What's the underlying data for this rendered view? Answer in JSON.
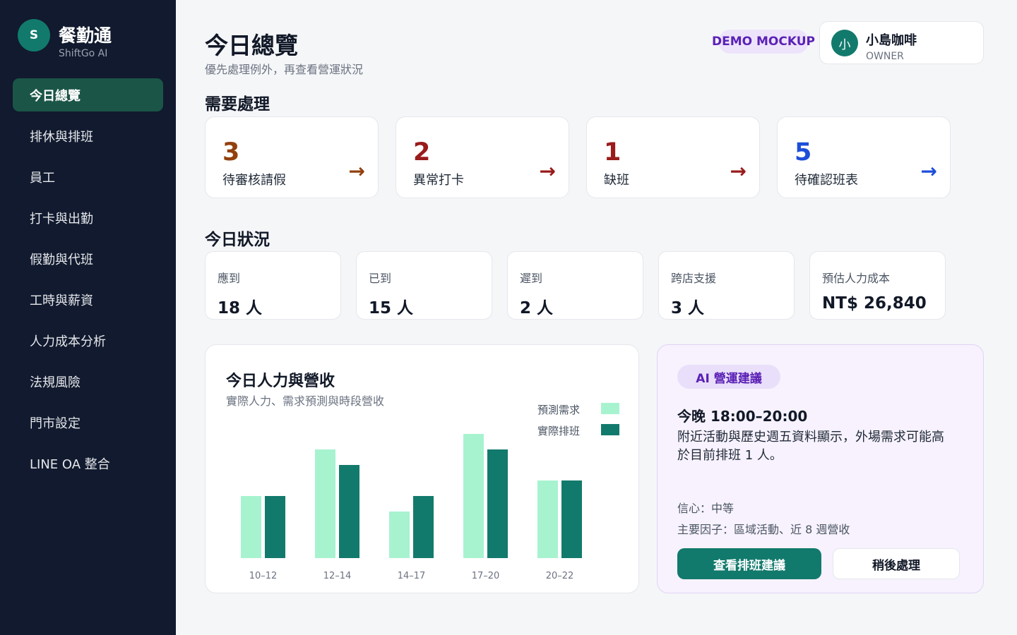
{
  "brand": {
    "logo_letter": "S",
    "name": "餐勤通",
    "subtitle": "ShiftGo AI"
  },
  "sidebar": {
    "items": [
      {
        "label": "今日總覽",
        "active": true
      },
      {
        "label": "排休與排班"
      },
      {
        "label": "員工"
      },
      {
        "label": "打卡與出勤"
      },
      {
        "label": "假勤與代班"
      },
      {
        "label": "工時與薪資"
      },
      {
        "label": "人力成本分析"
      },
      {
        "label": "法規風險"
      },
      {
        "label": "門市設定"
      },
      {
        "label": "LINE OA 整合"
      }
    ]
  },
  "header": {
    "title": "今日總覽",
    "subtitle": "優先處理例外，再查看營運狀況",
    "demo_badge": "DEMO MOCKUP",
    "user": {
      "avatar_letter": "小",
      "name": "小島咖啡",
      "role": "OWNER"
    }
  },
  "needs_attention": {
    "title": "需要處理",
    "cards": [
      {
        "count": "3",
        "label": "待審核請假",
        "color": "#92400e",
        "arrow": "→"
      },
      {
        "count": "2",
        "label": "異常打卡",
        "color": "#991b1b",
        "arrow": "→"
      },
      {
        "count": "1",
        "label": "缺班",
        "color": "#991b1b",
        "arrow": "→"
      },
      {
        "count": "5",
        "label": "待確認班表",
        "color": "#1d4ed8",
        "arrow": "→"
      }
    ]
  },
  "today_status": {
    "title": "今日狀況",
    "stats": [
      {
        "label": "應到",
        "value": "18 人"
      },
      {
        "label": "已到",
        "value": "15 人"
      },
      {
        "label": "遲到",
        "value": "2 人"
      },
      {
        "label": "跨店支援",
        "value": "3 人"
      },
      {
        "label": "預估人力成本",
        "value": "NT$ 26,840"
      }
    ]
  },
  "chart_panel": {
    "title": "今日人力與營收",
    "subtitle": "實際人力、需求預測與時段營收"
  },
  "chart_data": {
    "type": "bar",
    "categories": [
      "10–12",
      "12–14",
      "14–17",
      "17–20",
      "20–22"
    ],
    "series": [
      {
        "name": "預測需求",
        "values": [
          4,
          7,
          3,
          8,
          5
        ],
        "color": "#a7f3d0"
      },
      {
        "name": "實際排班",
        "values": [
          4,
          6,
          4,
          7,
          5
        ],
        "color": "#127a6c"
      }
    ],
    "ylim": [
      0,
      8
    ],
    "grid": false,
    "legend": "top-right"
  },
  "ai_panel": {
    "badge": "AI 營運建議",
    "time": "今晚 18:00–20:00",
    "description": "附近活動與歷史週五資料顯示，外場需求可能高於目前排班 1 人。",
    "confidence": "信心：中等",
    "factors": "主要因子：區域活動、近 8 週營收",
    "primary_button": "查看排班建議",
    "secondary_button": "稍後處理"
  }
}
